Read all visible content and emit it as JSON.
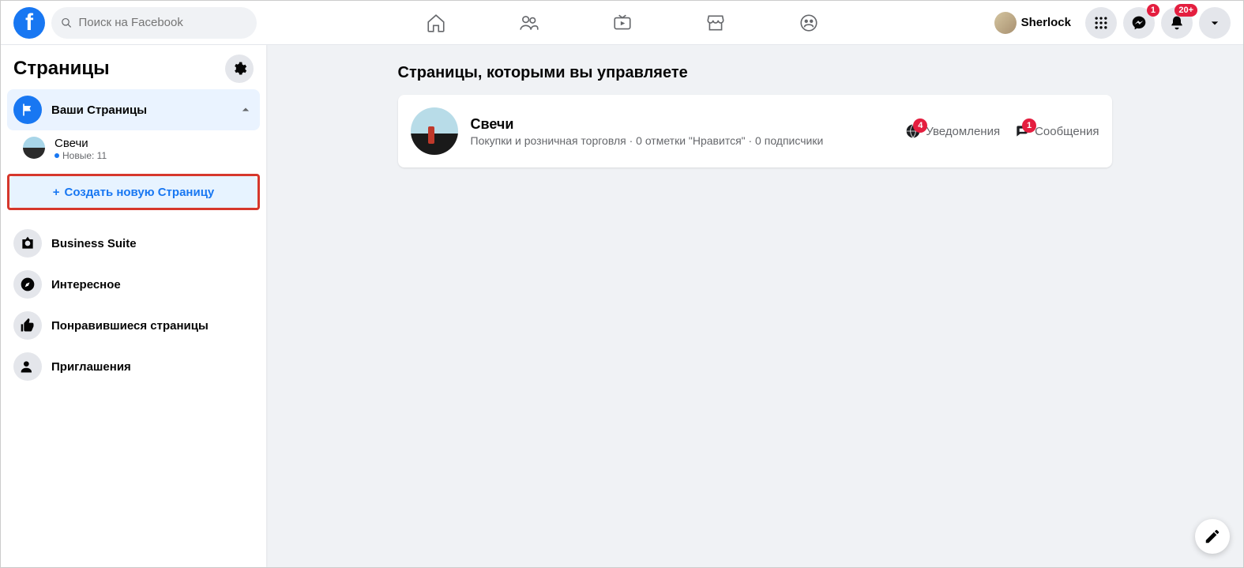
{
  "header": {
    "search_placeholder": "Поиск на Facebook",
    "profile_name": "Sherlock",
    "messenger_badge": "1",
    "notifications_badge": "20+"
  },
  "sidebar": {
    "title": "Страницы",
    "your_pages_label": "Ваши Страницы",
    "page": {
      "name": "Свечи",
      "meta": "Новые: 11"
    },
    "create_button": "Создать новую Страницу",
    "items": {
      "business_suite": "Business Suite",
      "interesting": "Интересное",
      "liked_pages": "Понравившиеся страницы",
      "invites": "Приглашения"
    }
  },
  "main": {
    "title": "Страницы, которыми вы управляете",
    "card": {
      "title": "Свечи",
      "subtitle": "Покупки и розничная торговля · 0 отметки \"Нравится\" · 0 подписчики",
      "notifications_label": "Уведомления",
      "notifications_badge": "4",
      "messages_label": "Сообщения",
      "messages_badge": "1"
    }
  }
}
